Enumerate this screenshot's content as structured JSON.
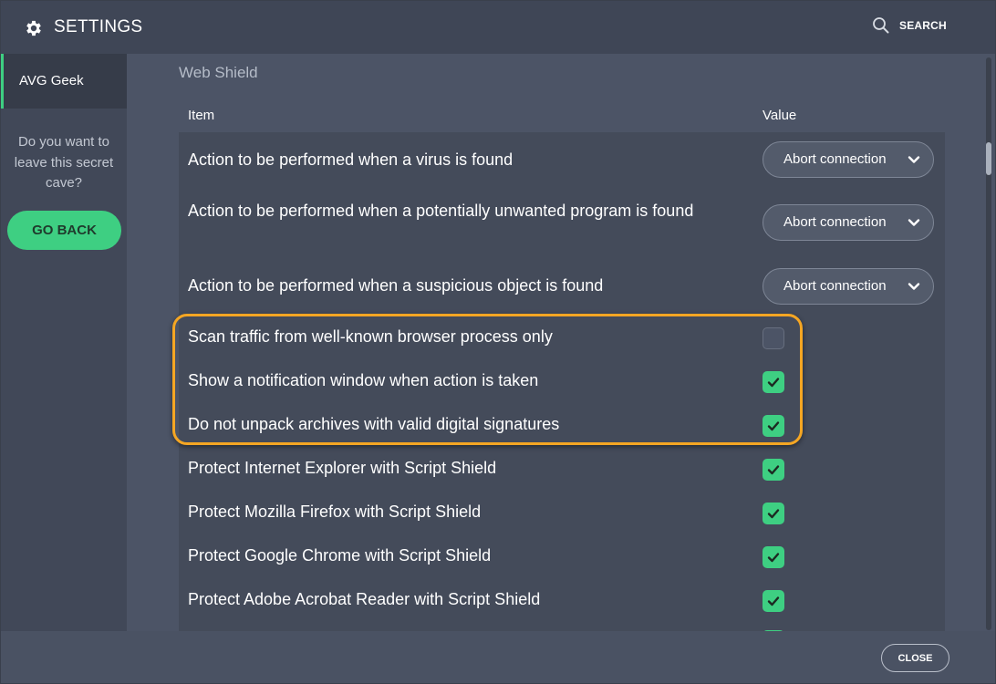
{
  "titlebar": {
    "title": "SETTINGS",
    "title_icon": "gear-icon",
    "search_icon": "search-icon",
    "search_label": "SEARCH"
  },
  "sidebar": {
    "items": [
      {
        "label": "AVG Geek",
        "selected": true
      }
    ],
    "question": "Do you want to leave this secret cave?",
    "go_back_label": "GO BACK"
  },
  "main": {
    "section_title": "Web Shield",
    "columns": {
      "item": "Item",
      "value": "Value"
    },
    "rows": [
      {
        "label": "Action to be performed when a virus is found",
        "type": "dropdown",
        "value": "Abort connection"
      },
      {
        "label": "Action to be performed when a potentially unwanted program is found",
        "type": "dropdown",
        "value": "Abort connection"
      },
      {
        "label": "Action to be performed when a suspicious object is found",
        "type": "dropdown",
        "value": "Abort connection"
      },
      {
        "label": "Scan traffic from well-known browser process only",
        "type": "checkbox",
        "checked": false
      },
      {
        "label": "Show a notification window when action is taken",
        "type": "checkbox",
        "checked": true
      },
      {
        "label": "Do not unpack archives with valid digital signatures",
        "type": "checkbox",
        "checked": true
      },
      {
        "label": "Protect Internet Explorer with Script Shield",
        "type": "checkbox",
        "checked": true
      },
      {
        "label": "Protect Mozilla Firefox with Script Shield",
        "type": "checkbox",
        "checked": true
      },
      {
        "label": "Protect Google Chrome with Script Shield",
        "type": "checkbox",
        "checked": true
      },
      {
        "label": "Protect Adobe Acrobat Reader with Script Shield",
        "type": "checkbox",
        "checked": true
      },
      {
        "label": "",
        "type": "checkbox",
        "checked": true
      }
    ],
    "highlight_color": "#f5a623",
    "accent_color": "#3ecf82"
  },
  "footer": {
    "close_label": "CLOSE"
  }
}
